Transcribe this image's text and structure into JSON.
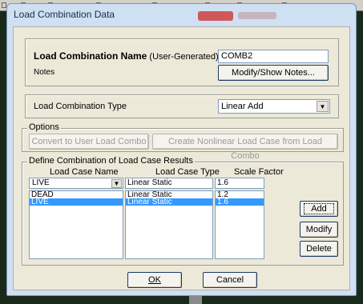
{
  "window": {
    "title": "Load Combination Data"
  },
  "name_section": {
    "name_label": "Load Combination Name",
    "name_suffix": "(User-Generated)",
    "name_value": "COMB2",
    "notes_label": "Notes",
    "notes_button": "Modify/Show Notes..."
  },
  "type_section": {
    "label": "Load Combination Type",
    "selected": "Linear Add"
  },
  "options": {
    "group_label": "Options",
    "convert_button": "Convert to User Load Combo",
    "create_button": "Create Nonlinear Load Case from Load Combo"
  },
  "define": {
    "group_label": "Define Combination of Load Case Results",
    "headers": {
      "name": "Load Case Name",
      "type": "Load Case Type",
      "factor": "Scale Factor"
    },
    "current": {
      "name": "LIVE",
      "type": "Linear Static",
      "factor": "1.6"
    },
    "rows": [
      {
        "name": "DEAD",
        "type": "Linear Static",
        "factor": "1.2",
        "selected": false
      },
      {
        "name": "LIVE",
        "type": "Linear Static",
        "factor": "1.6",
        "selected": true
      }
    ],
    "add_button": "Add",
    "modify_button": "Modify",
    "delete_button": "Delete"
  },
  "footer": {
    "ok_button": "OK",
    "cancel_button": "Cancel"
  },
  "icons": {
    "dropdown": "chevron-down-icon"
  },
  "colors": {
    "selection": "#3399ff",
    "window_frame": "#cfe0f3",
    "dialog_bg": "#ece9d8"
  }
}
